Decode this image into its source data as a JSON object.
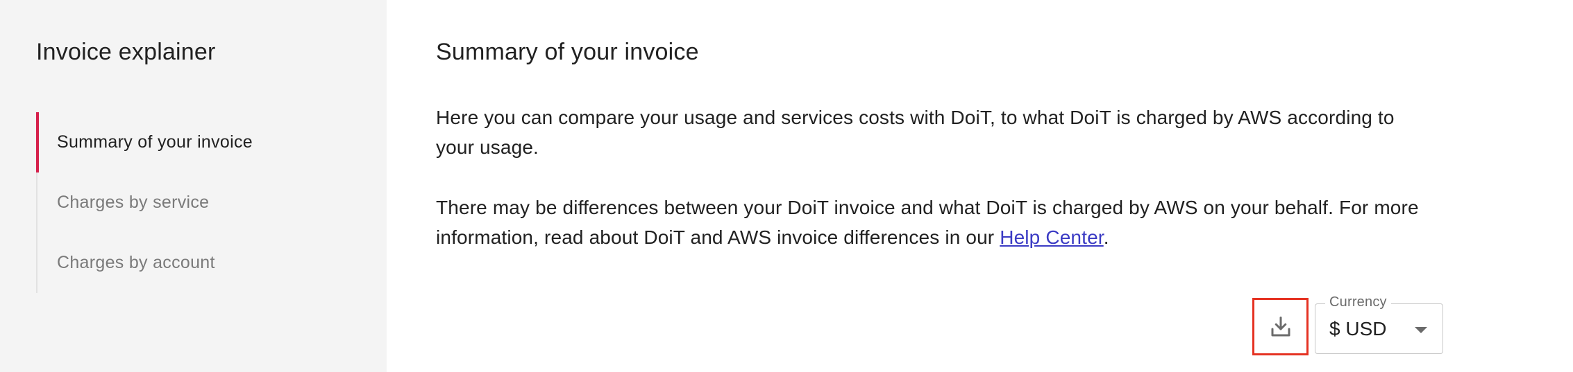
{
  "sidebar": {
    "title": "Invoice explainer",
    "items": [
      {
        "label": "Summary of your invoice",
        "active": true
      },
      {
        "label": "Charges by service",
        "active": false
      },
      {
        "label": "Charges by account",
        "active": false
      }
    ],
    "accent_color": "#d6204b"
  },
  "main": {
    "title": "Summary of your invoice",
    "paragraph_1": "Here you can compare your usage and services costs with DoiT, to what DoiT is charged by AWS according to your usage.",
    "paragraph_2_prefix": "There may be differences between your DoiT invoice and what DoiT is charged by AWS on your behalf. For more information, read about DoiT and AWS invoice differences in our ",
    "help_link": "Help Center",
    "paragraph_2_suffix": "."
  },
  "toolbar": {
    "download_icon": "download-icon",
    "highlight_color": "#e53222",
    "currency": {
      "label": "Currency",
      "value": "$ USD"
    }
  }
}
